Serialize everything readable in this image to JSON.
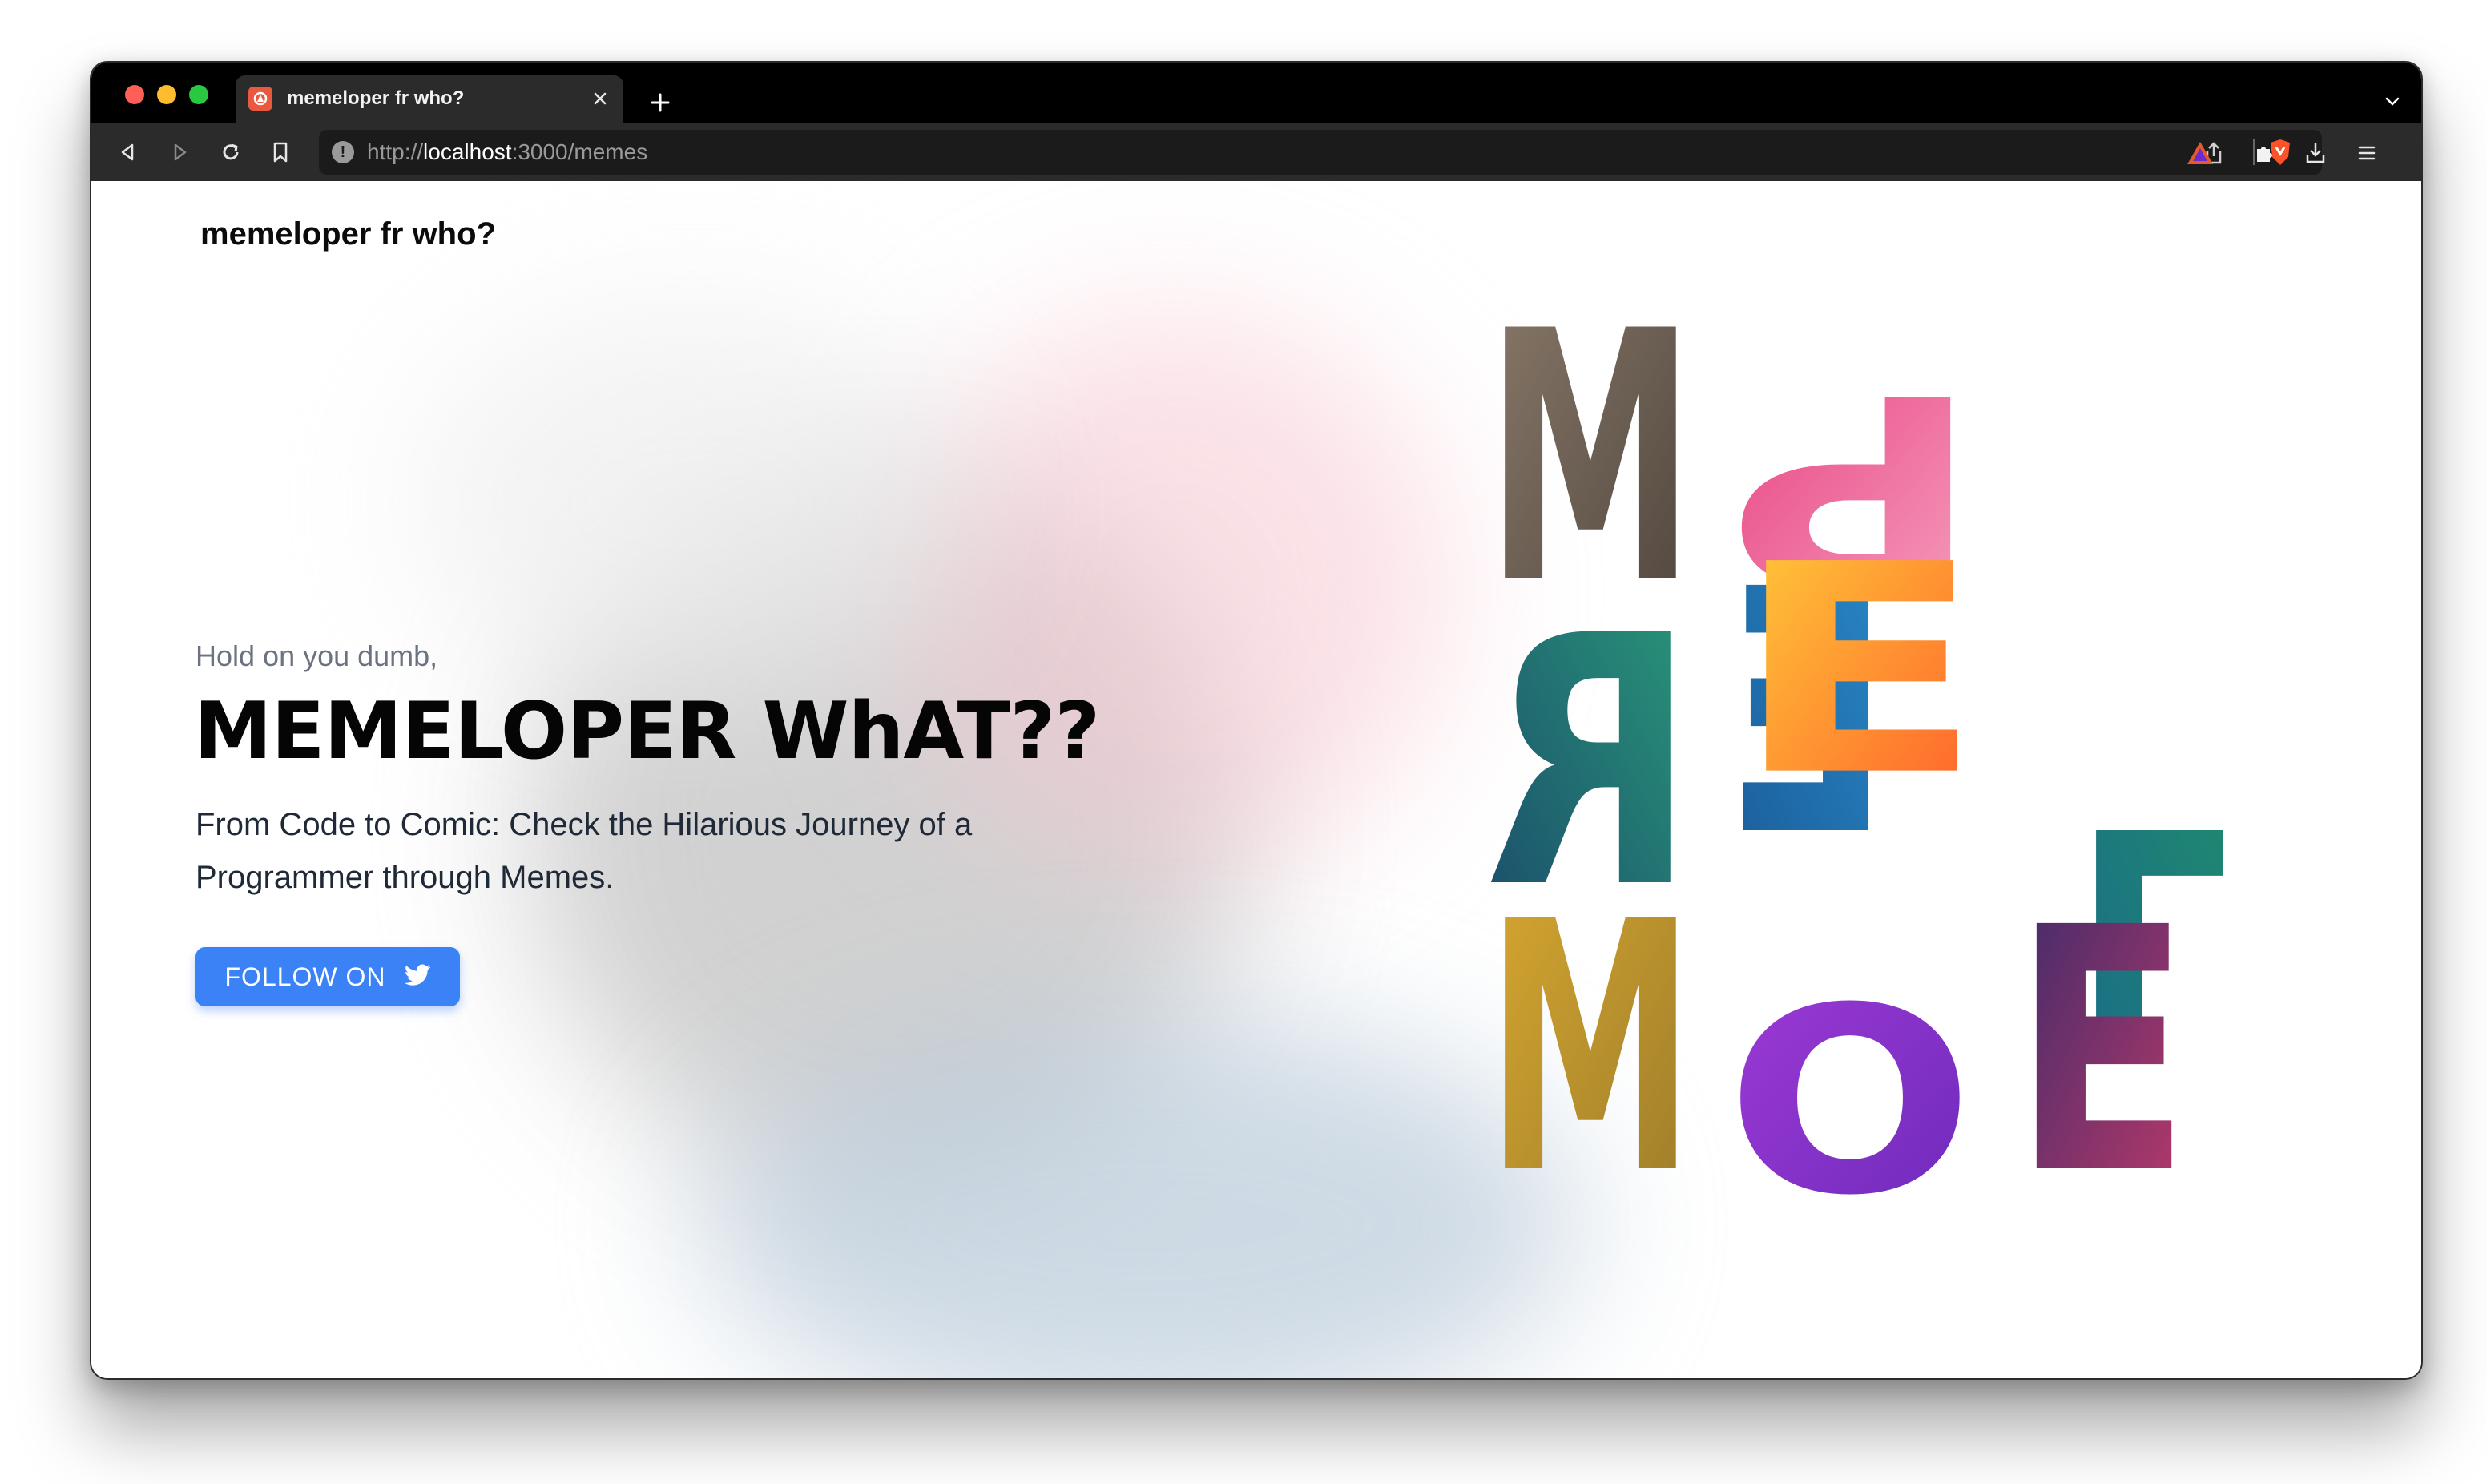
{
  "browser": {
    "tab_title": "memeloper fr who?",
    "url_scheme": "http://",
    "url_host": "localhost",
    "url_rest": ":3000/memes"
  },
  "site": {
    "brand": "memeloper fr who?"
  },
  "hero": {
    "kicker": "Hold on you dumb,",
    "title": "MEMELOPER WhAT??",
    "description": "From Code to Comic: Check the Hilarious Journey of a Programmer through Memes.",
    "button_label": "FOLLOW ON",
    "button_icon": "twitter-icon"
  },
  "art": {
    "letters": [
      "M",
      "E",
      "M",
      "E",
      "L",
      "O",
      "P",
      "E",
      "R"
    ],
    "colors": [
      "#6f6358",
      "#e8518b",
      "#1a6ea8",
      "#2a8a8a",
      "#157a6e",
      "#ff7a2a",
      "#c79a1e",
      "#8a2bd0",
      "#7a2a6a"
    ]
  },
  "colors": {
    "accent": "#3b82f6",
    "titlebar": "#000000",
    "toolbar": "#2b2b2b"
  }
}
